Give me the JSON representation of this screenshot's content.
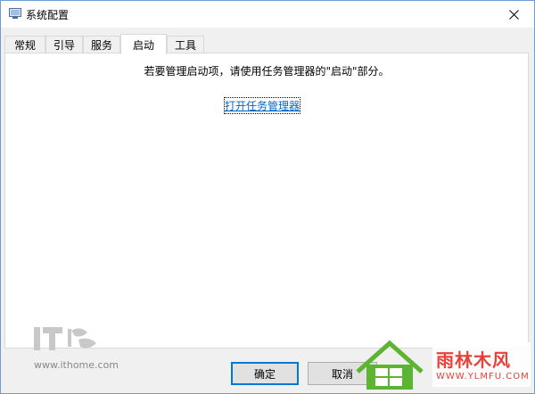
{
  "window": {
    "title": "系统配置"
  },
  "tabs": [
    {
      "label": "常规"
    },
    {
      "label": "引导"
    },
    {
      "label": "服务"
    },
    {
      "label": "启动",
      "active": true
    },
    {
      "label": "工具"
    }
  ],
  "startup": {
    "message": "若要管理启动项，请使用任务管理器的\"启动\"部分。",
    "link_label": "打开任务管理器"
  },
  "buttons": {
    "ok": "确定",
    "cancel": "取消"
  },
  "watermarks": {
    "it_logo": "IT",
    "it_url": "www.ithome.com",
    "site_title": "雨林木风",
    "site_url": "WWW.YLMFU.COM"
  },
  "colors": {
    "accent": "#0078d7",
    "link": "#0066cc",
    "watermark_red": "#e8413a"
  },
  "icons": {
    "app": "msconfig-icon",
    "close": "close-icon",
    "windows_logo": "windows-logo-icon"
  }
}
